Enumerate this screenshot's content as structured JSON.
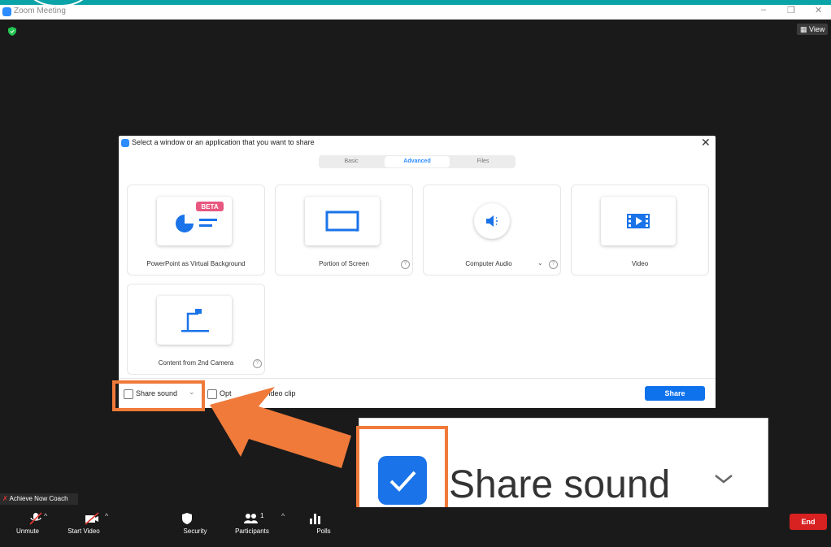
{
  "window": {
    "title": "Zoom Meeting",
    "controls": [
      "–",
      "❐",
      "✕"
    ],
    "view_label": "View"
  },
  "dialog": {
    "title": "Select a window or an application that you want to share",
    "tabs": [
      {
        "label": "Basic",
        "active": false
      },
      {
        "label": "Advanced",
        "active": true
      },
      {
        "label": "Files",
        "active": false
      }
    ],
    "cards": [
      {
        "label": "PowerPoint as Virtual Background",
        "badge": "BETA",
        "icon": "powerpoint-icon"
      },
      {
        "label": "Portion of Screen",
        "icon": "screen-portion-icon"
      },
      {
        "label": "Computer Audio",
        "icon": "speaker-icon"
      },
      {
        "label": "Video",
        "icon": "film-icon"
      },
      {
        "label": "Content from 2nd Camera",
        "icon": "camera-icon"
      }
    ],
    "footer": {
      "share_sound_label": "Share sound",
      "optimize_label_left": "Opt",
      "optimize_label_right": "video clip",
      "share_button": "Share"
    }
  },
  "toolbar": {
    "participant_name": "Achieve Now Coach",
    "items": [
      {
        "label": "Unmute",
        "icon": "mic-muted-icon"
      },
      {
        "label": "Start Video",
        "icon": "video-off-icon"
      },
      {
        "label": "Security",
        "icon": "security-shield-icon"
      },
      {
        "label": "Participants",
        "icon": "participants-icon",
        "count": "1"
      },
      {
        "label": "Polls",
        "icon": "polls-icon"
      }
    ],
    "end_label": "End"
  },
  "callout": {
    "label": "Share sound",
    "checked": true
  },
  "colors": {
    "accent": "#2d8cff",
    "highlight": "#ef7a3a",
    "end": "#d82121",
    "teal": "#0aa3a7"
  }
}
